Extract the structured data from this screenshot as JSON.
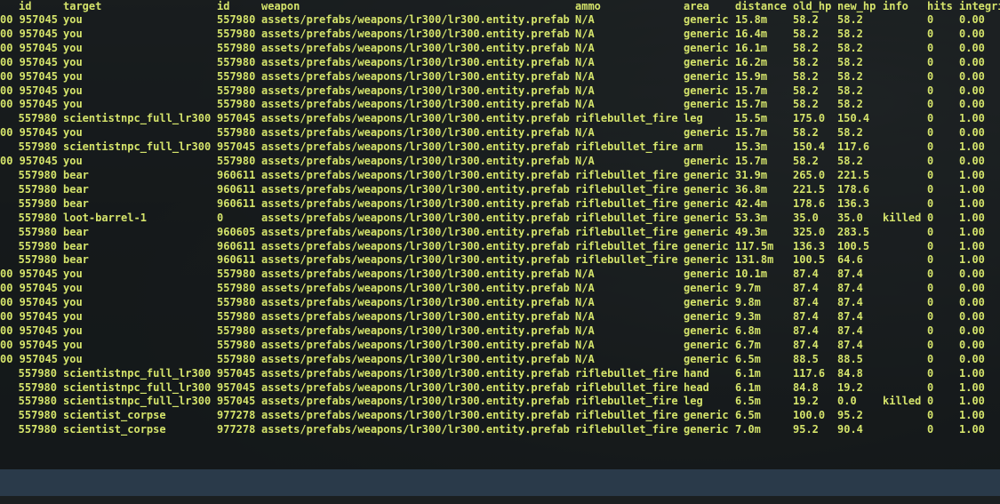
{
  "columns": {
    "attacker_id": "id",
    "target": "target",
    "target_id": "id",
    "weapon": "weapon",
    "ammo": "ammo",
    "area": "area",
    "distance": "distance",
    "old_hp": "old_hp",
    "new_hp": "new_hp",
    "info": "info",
    "hits": "hits",
    "integrity": "integri"
  },
  "rows": [
    {
      "aid": "00 957045",
      "target": "you",
      "tid": "557980",
      "weapon": "assets/prefabs/weapons/lr300/lr300.entity.prefab",
      "ammo": "N/A",
      "area": "generic",
      "dist": "15.8m",
      "old": "58.2",
      "new": "58.2",
      "info": "",
      "hits": "0",
      "int": "0.00"
    },
    {
      "aid": "00 957045",
      "target": "you",
      "tid": "557980",
      "weapon": "assets/prefabs/weapons/lr300/lr300.entity.prefab",
      "ammo": "N/A",
      "area": "generic",
      "dist": "16.4m",
      "old": "58.2",
      "new": "58.2",
      "info": "",
      "hits": "0",
      "int": "0.00"
    },
    {
      "aid": "00 957045",
      "target": "you",
      "tid": "557980",
      "weapon": "assets/prefabs/weapons/lr300/lr300.entity.prefab",
      "ammo": "N/A",
      "area": "generic",
      "dist": "16.1m",
      "old": "58.2",
      "new": "58.2",
      "info": "",
      "hits": "0",
      "int": "0.00"
    },
    {
      "aid": "00 957045",
      "target": "you",
      "tid": "557980",
      "weapon": "assets/prefabs/weapons/lr300/lr300.entity.prefab",
      "ammo": "N/A",
      "area": "generic",
      "dist": "16.2m",
      "old": "58.2",
      "new": "58.2",
      "info": "",
      "hits": "0",
      "int": "0.00"
    },
    {
      "aid": "00 957045",
      "target": "you",
      "tid": "557980",
      "weapon": "assets/prefabs/weapons/lr300/lr300.entity.prefab",
      "ammo": "N/A",
      "area": "generic",
      "dist": "15.9m",
      "old": "58.2",
      "new": "58.2",
      "info": "",
      "hits": "0",
      "int": "0.00"
    },
    {
      "aid": "00 957045",
      "target": "you",
      "tid": "557980",
      "weapon": "assets/prefabs/weapons/lr300/lr300.entity.prefab",
      "ammo": "N/A",
      "area": "generic",
      "dist": "15.7m",
      "old": "58.2",
      "new": "58.2",
      "info": "",
      "hits": "0",
      "int": "0.00"
    },
    {
      "aid": "00 957045",
      "target": "you",
      "tid": "557980",
      "weapon": "assets/prefabs/weapons/lr300/lr300.entity.prefab",
      "ammo": "N/A",
      "area": "generic",
      "dist": "15.7m",
      "old": "58.2",
      "new": "58.2",
      "info": "",
      "hits": "0",
      "int": "0.00"
    },
    {
      "aid": "557980",
      "target": "scientistnpc_full_lr300",
      "tid": "957045",
      "weapon": "assets/prefabs/weapons/lr300/lr300.entity.prefab",
      "ammo": "riflebullet_fire",
      "area": "leg",
      "dist": "15.5m",
      "old": "175.0",
      "new": "150.4",
      "info": "",
      "hits": "0",
      "int": "1.00"
    },
    {
      "aid": "00 957045",
      "target": "you",
      "tid": "557980",
      "weapon": "assets/prefabs/weapons/lr300/lr300.entity.prefab",
      "ammo": "N/A",
      "area": "generic",
      "dist": "15.7m",
      "old": "58.2",
      "new": "58.2",
      "info": "",
      "hits": "0",
      "int": "0.00"
    },
    {
      "aid": "557980",
      "target": "scientistnpc_full_lr300",
      "tid": "957045",
      "weapon": "assets/prefabs/weapons/lr300/lr300.entity.prefab",
      "ammo": "riflebullet_fire",
      "area": "arm",
      "dist": "15.3m",
      "old": "150.4",
      "new": "117.6",
      "info": "",
      "hits": "0",
      "int": "1.00"
    },
    {
      "aid": "00 957045",
      "target": "you",
      "tid": "557980",
      "weapon": "assets/prefabs/weapons/lr300/lr300.entity.prefab",
      "ammo": "N/A",
      "area": "generic",
      "dist": "15.7m",
      "old": "58.2",
      "new": "58.2",
      "info": "",
      "hits": "0",
      "int": "0.00"
    },
    {
      "aid": "557980",
      "target": "bear",
      "tid": "960611",
      "weapon": "assets/prefabs/weapons/lr300/lr300.entity.prefab",
      "ammo": "riflebullet_fire",
      "area": "generic",
      "dist": "31.9m",
      "old": "265.0",
      "new": "221.5",
      "info": "",
      "hits": "0",
      "int": "1.00"
    },
    {
      "aid": "557980",
      "target": "bear",
      "tid": "960611",
      "weapon": "assets/prefabs/weapons/lr300/lr300.entity.prefab",
      "ammo": "riflebullet_fire",
      "area": "generic",
      "dist": "36.8m",
      "old": "221.5",
      "new": "178.6",
      "info": "",
      "hits": "0",
      "int": "1.00"
    },
    {
      "aid": "557980",
      "target": "bear",
      "tid": "960611",
      "weapon": "assets/prefabs/weapons/lr300/lr300.entity.prefab",
      "ammo": "riflebullet_fire",
      "area": "generic",
      "dist": "42.4m",
      "old": "178.6",
      "new": "136.3",
      "info": "",
      "hits": "0",
      "int": "1.00"
    },
    {
      "aid": "557980",
      "target": "loot-barrel-1",
      "tid": "0",
      "weapon": "assets/prefabs/weapons/lr300/lr300.entity.prefab",
      "ammo": "riflebullet_fire",
      "area": "generic",
      "dist": "53.3m",
      "old": "35.0",
      "new": "35.0",
      "info": "killed",
      "hits": "0",
      "int": "1.00"
    },
    {
      "aid": "557980",
      "target": "bear",
      "tid": "960605",
      "weapon": "assets/prefabs/weapons/lr300/lr300.entity.prefab",
      "ammo": "riflebullet_fire",
      "area": "generic",
      "dist": "49.3m",
      "old": "325.0",
      "new": "283.5",
      "info": "",
      "hits": "0",
      "int": "1.00"
    },
    {
      "aid": "557980",
      "target": "bear",
      "tid": "960611",
      "weapon": "assets/prefabs/weapons/lr300/lr300.entity.prefab",
      "ammo": "riflebullet_fire",
      "area": "generic",
      "dist": "117.5m",
      "old": "136.3",
      "new": "100.5",
      "info": "",
      "hits": "0",
      "int": "1.00"
    },
    {
      "aid": "557980",
      "target": "bear",
      "tid": "960611",
      "weapon": "assets/prefabs/weapons/lr300/lr300.entity.prefab",
      "ammo": "riflebullet_fire",
      "area": "generic",
      "dist": "131.8m",
      "old": "100.5",
      "new": "64.6",
      "info": "",
      "hits": "0",
      "int": "1.00"
    },
    {
      "aid": "00 957045",
      "target": "you",
      "tid": "557980",
      "weapon": "assets/prefabs/weapons/lr300/lr300.entity.prefab",
      "ammo": "N/A",
      "area": "generic",
      "dist": "10.1m",
      "old": "87.4",
      "new": "87.4",
      "info": "",
      "hits": "0",
      "int": "0.00"
    },
    {
      "aid": "00 957045",
      "target": "you",
      "tid": "557980",
      "weapon": "assets/prefabs/weapons/lr300/lr300.entity.prefab",
      "ammo": "N/A",
      "area": "generic",
      "dist": "9.7m",
      "old": "87.4",
      "new": "87.4",
      "info": "",
      "hits": "0",
      "int": "0.00"
    },
    {
      "aid": "00 957045",
      "target": "you",
      "tid": "557980",
      "weapon": "assets/prefabs/weapons/lr300/lr300.entity.prefab",
      "ammo": "N/A",
      "area": "generic",
      "dist": "9.8m",
      "old": "87.4",
      "new": "87.4",
      "info": "",
      "hits": "0",
      "int": "0.00"
    },
    {
      "aid": "00 957045",
      "target": "you",
      "tid": "557980",
      "weapon": "assets/prefabs/weapons/lr300/lr300.entity.prefab",
      "ammo": "N/A",
      "area": "generic",
      "dist": "9.3m",
      "old": "87.4",
      "new": "87.4",
      "info": "",
      "hits": "0",
      "int": "0.00"
    },
    {
      "aid": "00 957045",
      "target": "you",
      "tid": "557980",
      "weapon": "assets/prefabs/weapons/lr300/lr300.entity.prefab",
      "ammo": "N/A",
      "area": "generic",
      "dist": "6.8m",
      "old": "87.4",
      "new": "87.4",
      "info": "",
      "hits": "0",
      "int": "0.00"
    },
    {
      "aid": "00 957045",
      "target": "you",
      "tid": "557980",
      "weapon": "assets/prefabs/weapons/lr300/lr300.entity.prefab",
      "ammo": "N/A",
      "area": "generic",
      "dist": "6.7m",
      "old": "87.4",
      "new": "87.4",
      "info": "",
      "hits": "0",
      "int": "0.00"
    },
    {
      "aid": "00 957045",
      "target": "you",
      "tid": "557980",
      "weapon": "assets/prefabs/weapons/lr300/lr300.entity.prefab",
      "ammo": "N/A",
      "area": "generic",
      "dist": "6.5m",
      "old": "88.5",
      "new": "88.5",
      "info": "",
      "hits": "0",
      "int": "0.00"
    },
    {
      "aid": "557980",
      "target": "scientistnpc_full_lr300",
      "tid": "957045",
      "weapon": "assets/prefabs/weapons/lr300/lr300.entity.prefab",
      "ammo": "riflebullet_fire",
      "area": "hand",
      "dist": "6.1m",
      "old": "117.6",
      "new": "84.8",
      "info": "",
      "hits": "0",
      "int": "1.00"
    },
    {
      "aid": "557980",
      "target": "scientistnpc_full_lr300",
      "tid": "957045",
      "weapon": "assets/prefabs/weapons/lr300/lr300.entity.prefab",
      "ammo": "riflebullet_fire",
      "area": "head",
      "dist": "6.1m",
      "old": "84.8",
      "new": "19.2",
      "info": "",
      "hits": "0",
      "int": "1.00"
    },
    {
      "aid": "557980",
      "target": "scientistnpc_full_lr300",
      "tid": "957045",
      "weapon": "assets/prefabs/weapons/lr300/lr300.entity.prefab",
      "ammo": "riflebullet_fire",
      "area": "leg",
      "dist": "6.5m",
      "old": "19.2",
      "new": "0.0",
      "info": "killed",
      "hits": "0",
      "int": "1.00"
    },
    {
      "aid": "557980",
      "target": "scientist_corpse",
      "tid": "977278",
      "weapon": "assets/prefabs/weapons/lr300/lr300.entity.prefab",
      "ammo": "riflebullet_fire",
      "area": "generic",
      "dist": "6.5m",
      "old": "100.0",
      "new": "95.2",
      "info": "",
      "hits": "0",
      "int": "1.00"
    },
    {
      "aid": "557980",
      "target": "scientist_corpse",
      "tid": "977278",
      "weapon": "assets/prefabs/weapons/lr300/lr300.entity.prefab",
      "ammo": "riflebullet_fire",
      "area": "generic",
      "dist": "7.0m",
      "old": "95.2",
      "new": "90.4",
      "info": "",
      "hits": "0",
      "int": "1.00"
    }
  ],
  "colors": {
    "text": "#d5e46b",
    "console_bg": "#121618",
    "input_bg": "#2a3a4a"
  }
}
